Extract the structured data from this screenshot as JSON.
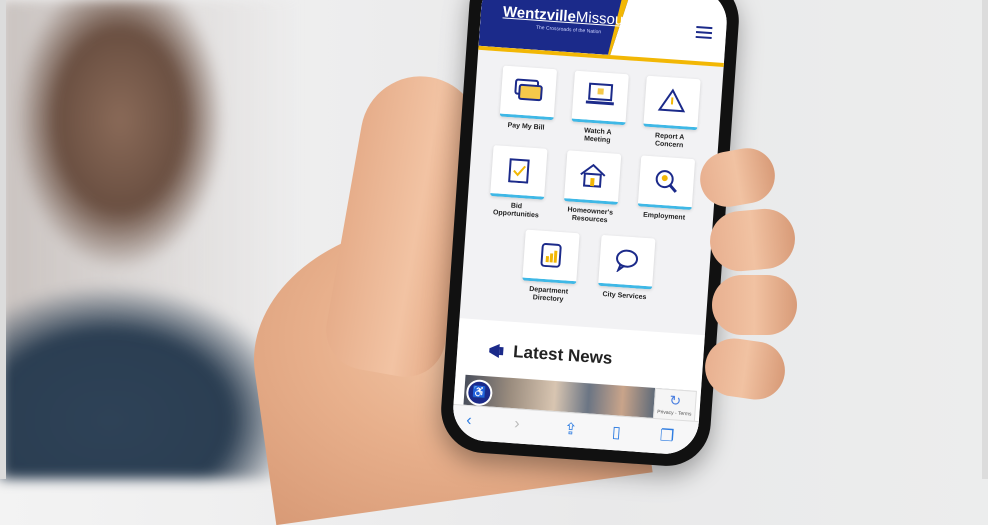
{
  "site": {
    "logo_main": "Wentzville",
    "logo_sub": "Missouri",
    "tagline": "The Crossroads of the Nation"
  },
  "tiles": [
    {
      "label": "Pay My Bill",
      "icon": "credit-card-icon"
    },
    {
      "label": "Watch A Meeting",
      "icon": "laptop-icon"
    },
    {
      "label": "Report A Concern",
      "icon": "warning-triangle-icon"
    },
    {
      "label": "Bid Opportunities",
      "icon": "clipboard-check-icon"
    },
    {
      "label": "Homeowner's Resources",
      "icon": "house-icon"
    },
    {
      "label": "Employment",
      "icon": "search-person-icon"
    },
    {
      "label": "Department Directory",
      "icon": "clipboard-chart-icon"
    },
    {
      "label": "City Services",
      "icon": "speech-bubble-icon"
    }
  ],
  "news": {
    "title": "Latest News"
  },
  "recaptcha": {
    "text": "Privacy - Terms"
  },
  "colors": {
    "brand": "#1b2a8a",
    "accent": "#f2b705",
    "tile_underline": "#3fb8e6"
  }
}
